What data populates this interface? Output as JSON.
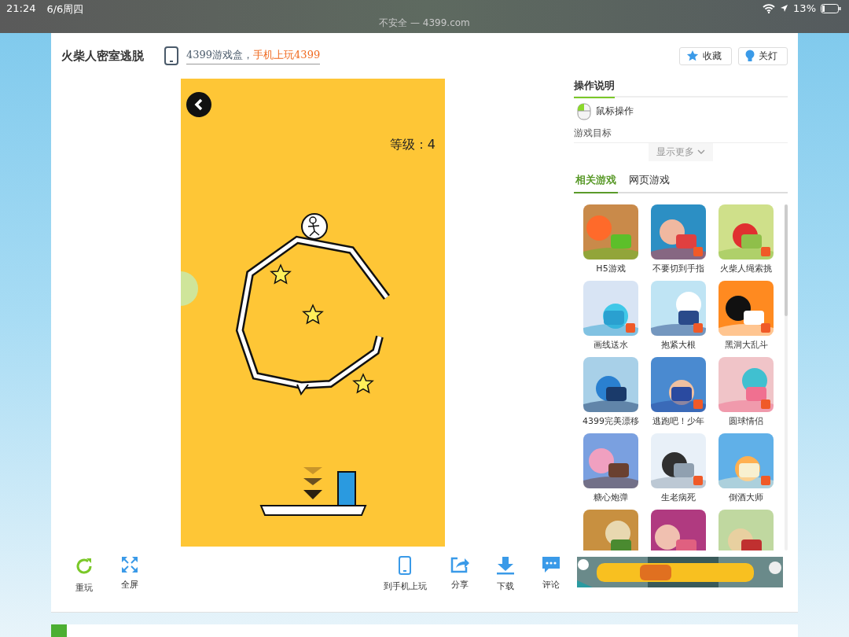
{
  "status_bar": {
    "time": "21:24",
    "date": "6/6周四",
    "battery": "13%"
  },
  "address_bar": {
    "text": "不安全 — 4399.com"
  },
  "header": {
    "title": "火柴人密室逃脱",
    "promo": "4399游戏盒，",
    "promo_highlight": "手机上玩4399",
    "buttons": [
      {
        "label": "收藏"
      },
      {
        "label": "关灯"
      }
    ]
  },
  "game": {
    "level_text": "等级：4"
  },
  "toolbar_left": [
    {
      "label": "重玩"
    },
    {
      "label": "全屏"
    }
  ],
  "toolbar_right": [
    {
      "label": "到手机上玩"
    },
    {
      "label": "分享"
    },
    {
      "label": "下载"
    },
    {
      "label": "评论"
    }
  ],
  "instructions": {
    "title": "操作说明",
    "control": "鼠标操作",
    "goal": "游戏目标",
    "more": "显示更多"
  },
  "game_tabs": [
    {
      "label": "相关游戏",
      "selected": true
    },
    {
      "label": "网页游戏",
      "selected": false
    }
  ],
  "related_games": [
    {
      "name": "H5游戏",
      "kind": "picture"
    },
    {
      "name": "不要切到手指",
      "kind": "picture"
    },
    {
      "name": "火柴人绳索挑",
      "kind": "picture"
    },
    {
      "name": "画线送水",
      "kind": "picture"
    },
    {
      "name": "抱紧大根",
      "kind": "picture"
    },
    {
      "name": "黑洞大乱斗",
      "kind": "picture"
    },
    {
      "name": "4399完美漂移",
      "kind": "picture"
    },
    {
      "name": "逃跑吧！少年",
      "kind": "picture"
    },
    {
      "name": "圆球情侣",
      "kind": "picture"
    },
    {
      "name": "糖心炮弹",
      "kind": "picture"
    },
    {
      "name": "生老病死",
      "kind": "picture"
    },
    {
      "name": "倒酒大师",
      "kind": "picture"
    },
    {
      "kind": "picture"
    },
    {
      "kind": "picture"
    },
    {
      "kind": "picture"
    }
  ],
  "banner": {
    "kind": "picture"
  }
}
